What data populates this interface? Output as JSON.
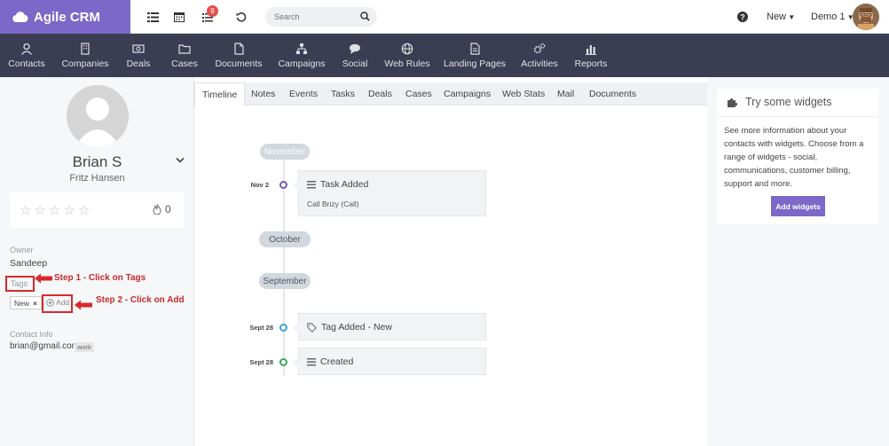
{
  "app": {
    "brand": "Agile CRM"
  },
  "topbar": {
    "notification_count": "9",
    "search_placeholder": "Search",
    "new_menu": "New",
    "user_menu": "Demo 1"
  },
  "nav": [
    {
      "label": "Contacts",
      "icon": "user-icon"
    },
    {
      "label": "Companies",
      "icon": "building-icon"
    },
    {
      "label": "Deals",
      "icon": "money-icon"
    },
    {
      "label": "Cases",
      "icon": "folder-icon"
    },
    {
      "label": "Documents",
      "icon": "document-icon"
    },
    {
      "label": "Campaigns",
      "icon": "sitemap-icon"
    },
    {
      "label": "Social",
      "icon": "chat-icon"
    },
    {
      "label": "Web Rules",
      "icon": "globe-icon"
    },
    {
      "label": "Landing Pages",
      "icon": "page-icon"
    },
    {
      "label": "Activities",
      "icon": "cogs-icon"
    },
    {
      "label": "Reports",
      "icon": "bar-chart-icon"
    }
  ],
  "contact": {
    "name": "Brian S",
    "company": "Fritz Hansen",
    "rating": 0,
    "score": "0",
    "owner_label": "Owner",
    "owner": "Sandeep",
    "tags_label": "Tags",
    "tag": "New",
    "tag_remove": "×",
    "add_label": "Add",
    "contact_info_label": "Contact Info",
    "email": "brian@gmail.com",
    "email_type": "work"
  },
  "annotations": {
    "step1": "Step 1 - Click on Tags",
    "step2": "Step 2 - Click on Add"
  },
  "tabs": [
    "Timeline",
    "Notes",
    "Events",
    "Tasks",
    "Deals",
    "Cases",
    "Campaigns",
    "Web Stats",
    "Mail",
    "Documents"
  ],
  "timeline": {
    "months": [
      "November",
      "October",
      "September"
    ],
    "events": [
      {
        "date": "Nov 2",
        "title": "Task Added",
        "sub": "Call Brizy (Call)",
        "dot_color": "#6b5fb5"
      },
      {
        "date": "Sept 28",
        "title": "Tag Added - New",
        "dot_color": "#3aa3d6"
      },
      {
        "date": "Sept 28",
        "title": "Created",
        "dot_color": "#3aa857"
      }
    ]
  },
  "widgets": {
    "title": "Try some widgets",
    "text": "See more information about your contacts with widgets. Choose from a range of widgets - social, communications, customer billing, support and more.",
    "button": "Add widgets"
  },
  "colors": {
    "brand": "#7b68c8",
    "nav_bg": "#3b3d52",
    "annotation_red": "#d82a2a"
  }
}
